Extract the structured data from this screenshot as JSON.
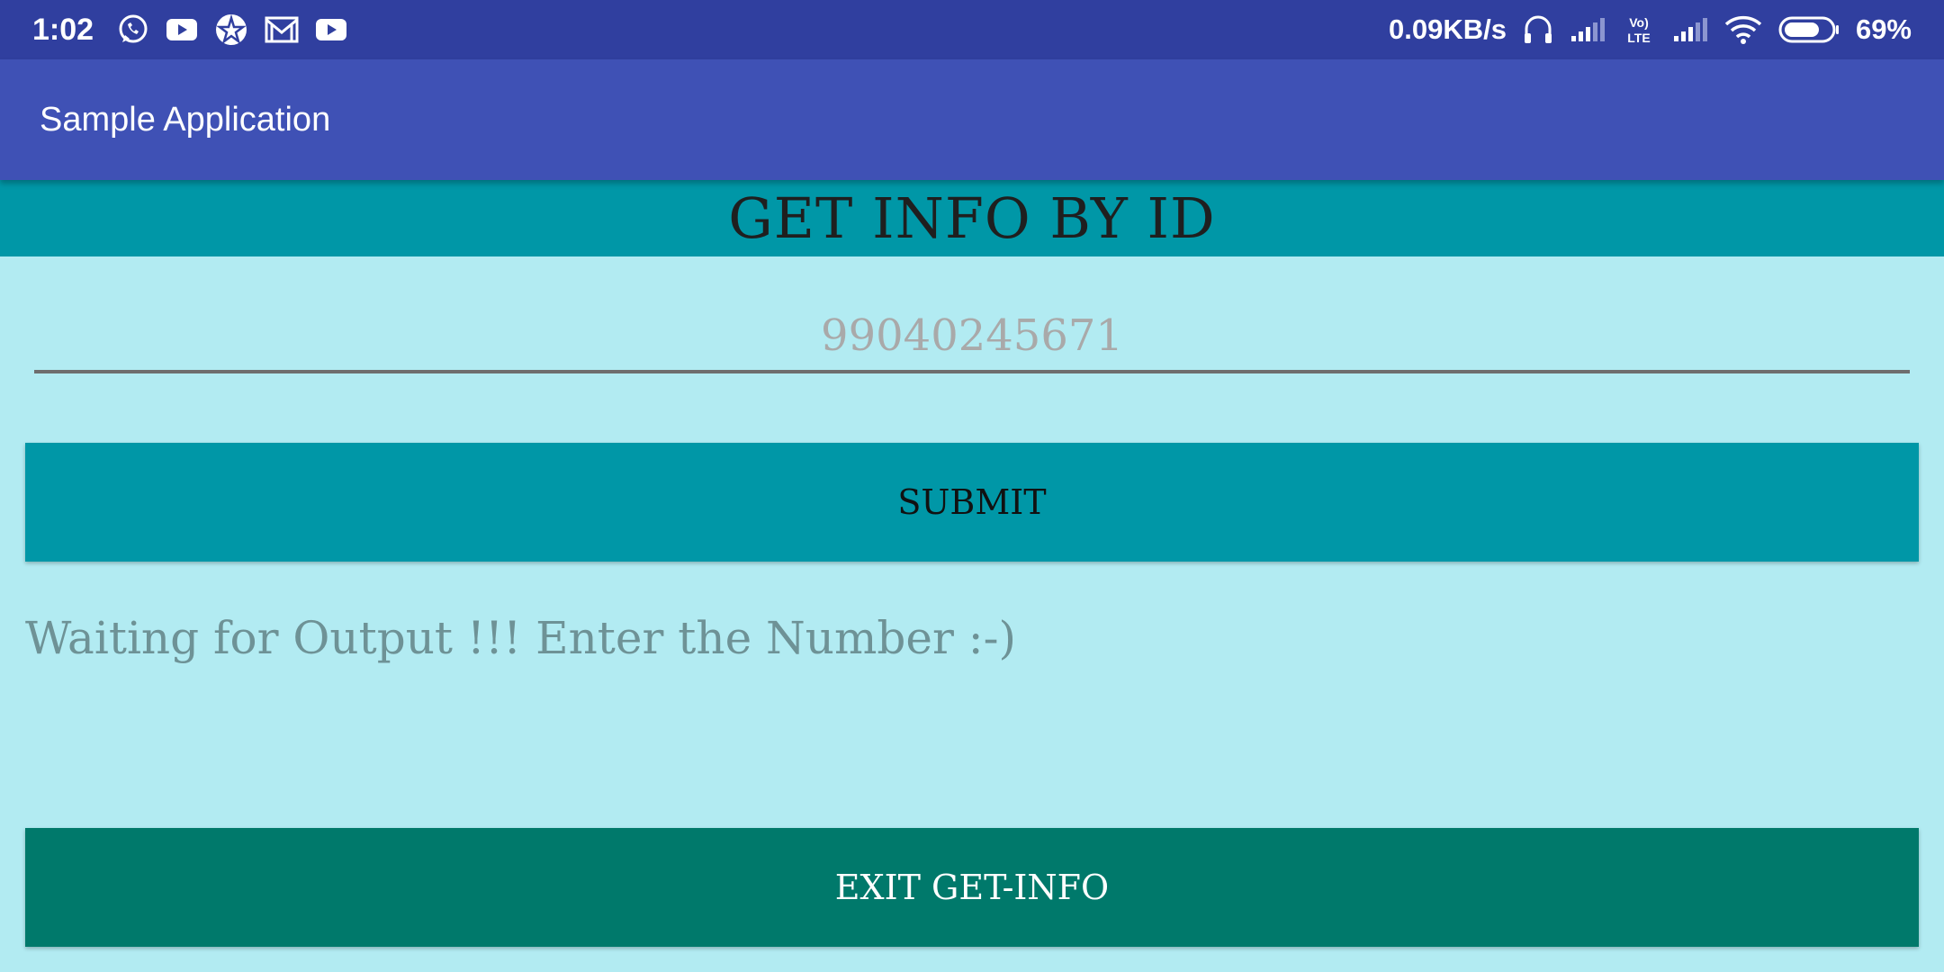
{
  "status_bar": {
    "time": "1:02",
    "left_icons": [
      "whatsapp-icon",
      "youtube-icon",
      "app-badge-icon",
      "mail-icon",
      "youtube-icon"
    ],
    "network_speed": "0.09KB/s",
    "right_icons": [
      "headset-icon",
      "signal-icon",
      "volte-icon",
      "signal-icon",
      "wifi-icon",
      "battery-icon"
    ],
    "volte_label": "Vo) LTE",
    "battery": "69%",
    "color": "#303f9f"
  },
  "app_bar": {
    "title": "Sample Application",
    "color": "#3f51b5"
  },
  "header": {
    "title": "GET INFO BY ID",
    "color": "#0097a7"
  },
  "id_input": {
    "value": "",
    "placeholder": "99040245671"
  },
  "submit_button": {
    "label": "SUBMIT",
    "color": "#0097a7"
  },
  "output": {
    "text": "Waiting for Output !!! Enter the Number :-)"
  },
  "exit_button": {
    "label": "EXIT GET-INFO",
    "color": "#00796b"
  },
  "background_color": "#b2ebf2"
}
